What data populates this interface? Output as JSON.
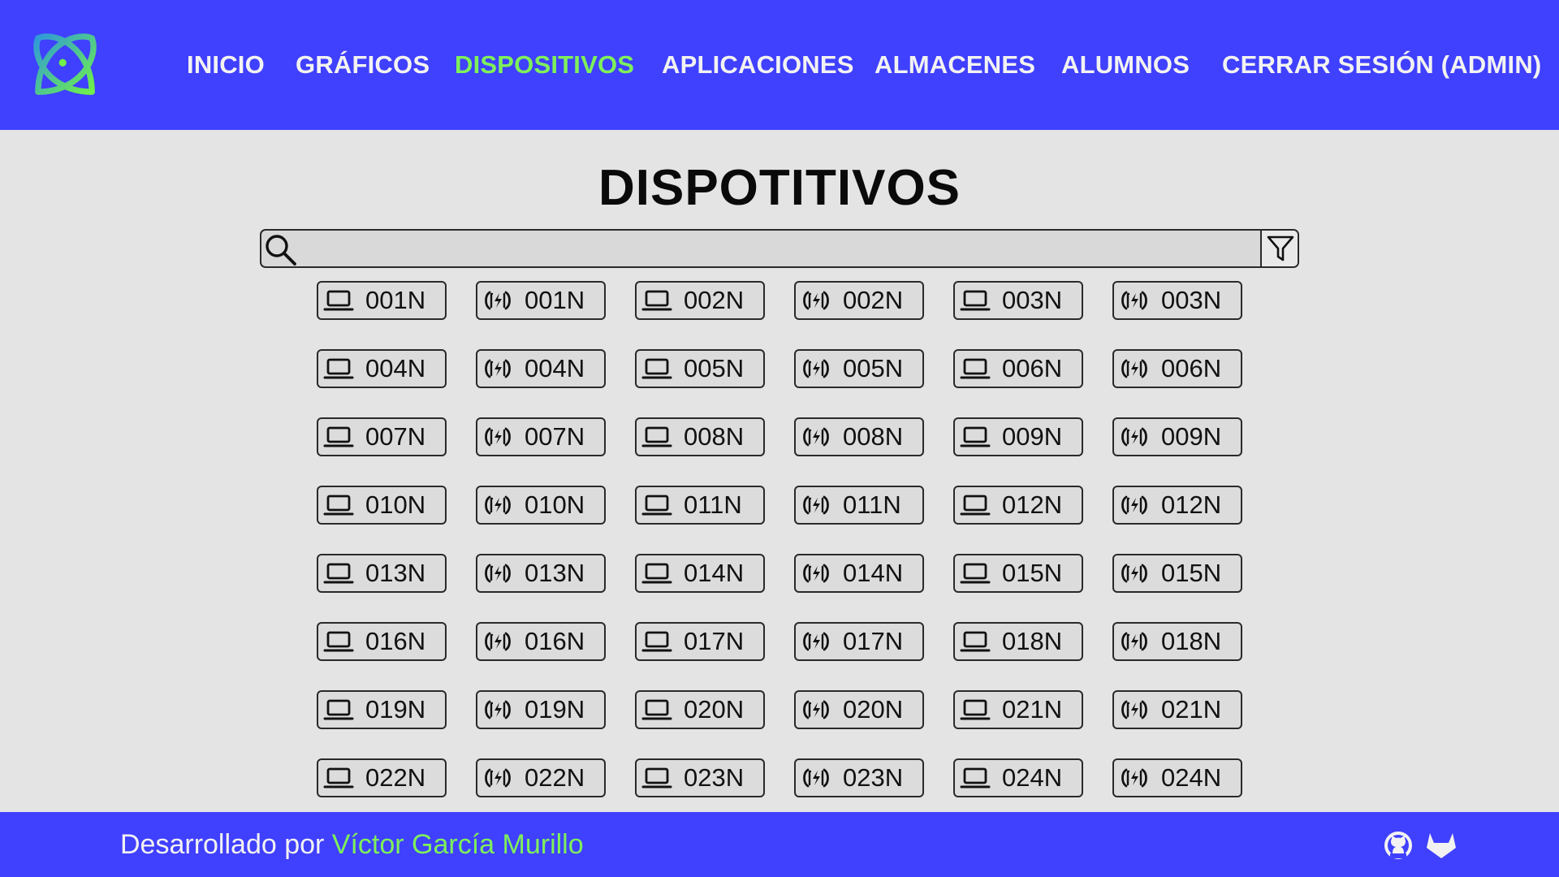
{
  "nav": {
    "items": [
      {
        "label": "INICIO",
        "active": false
      },
      {
        "label": "GRÁFICOS",
        "active": false
      },
      {
        "label": "DISPOSITIVOS",
        "active": true
      },
      {
        "label": "APLICACIONES",
        "active": false
      },
      {
        "label": "ALMACENES",
        "active": false
      },
      {
        "label": "ALUMNOS",
        "active": false
      },
      {
        "label": "CERRAR SESIÓN (ADMIN)",
        "active": false
      }
    ]
  },
  "page": {
    "title": "DISPOTITIVOS"
  },
  "search": {
    "value": "",
    "placeholder": "",
    "search_icon": "search-icon",
    "filter_icon": "filter-icon"
  },
  "devices": [
    {
      "type": "laptop",
      "label": "001N"
    },
    {
      "type": "charger",
      "label": "001N"
    },
    {
      "type": "laptop",
      "label": "002N"
    },
    {
      "type": "charger",
      "label": "002N"
    },
    {
      "type": "laptop",
      "label": "003N"
    },
    {
      "type": "charger",
      "label": "003N"
    },
    {
      "type": "laptop",
      "label": "004N"
    },
    {
      "type": "charger",
      "label": "004N"
    },
    {
      "type": "laptop",
      "label": "005N"
    },
    {
      "type": "charger",
      "label": "005N"
    },
    {
      "type": "laptop",
      "label": "006N"
    },
    {
      "type": "charger",
      "label": "006N"
    },
    {
      "type": "laptop",
      "label": "007N"
    },
    {
      "type": "charger",
      "label": "007N"
    },
    {
      "type": "laptop",
      "label": "008N"
    },
    {
      "type": "charger",
      "label": "008N"
    },
    {
      "type": "laptop",
      "label": "009N"
    },
    {
      "type": "charger",
      "label": "009N"
    },
    {
      "type": "laptop",
      "label": "010N"
    },
    {
      "type": "charger",
      "label": "010N"
    },
    {
      "type": "laptop",
      "label": "011N"
    },
    {
      "type": "charger",
      "label": "011N"
    },
    {
      "type": "laptop",
      "label": "012N"
    },
    {
      "type": "charger",
      "label": "012N"
    },
    {
      "type": "laptop",
      "label": "013N"
    },
    {
      "type": "charger",
      "label": "013N"
    },
    {
      "type": "laptop",
      "label": "014N"
    },
    {
      "type": "charger",
      "label": "014N"
    },
    {
      "type": "laptop",
      "label": "015N"
    },
    {
      "type": "charger",
      "label": "015N"
    },
    {
      "type": "laptop",
      "label": "016N"
    },
    {
      "type": "charger",
      "label": "016N"
    },
    {
      "type": "laptop",
      "label": "017N"
    },
    {
      "type": "charger",
      "label": "017N"
    },
    {
      "type": "laptop",
      "label": "018N"
    },
    {
      "type": "charger",
      "label": "018N"
    },
    {
      "type": "laptop",
      "label": "019N"
    },
    {
      "type": "charger",
      "label": "019N"
    },
    {
      "type": "laptop",
      "label": "020N"
    },
    {
      "type": "charger",
      "label": "020N"
    },
    {
      "type": "laptop",
      "label": "021N"
    },
    {
      "type": "charger",
      "label": "021N"
    },
    {
      "type": "laptop",
      "label": "022N"
    },
    {
      "type": "charger",
      "label": "022N"
    },
    {
      "type": "laptop",
      "label": "023N"
    },
    {
      "type": "charger",
      "label": "023N"
    },
    {
      "type": "laptop",
      "label": "024N"
    },
    {
      "type": "charger",
      "label": "024N"
    }
  ],
  "footer": {
    "prefix": "Desarrollado por ",
    "author": "Víctor García Murillo",
    "icons": [
      "github-icon",
      "gitlab-icon"
    ]
  },
  "colors": {
    "header_bg": "#4040ff",
    "accent": "#7ef05a",
    "nav_text": "#f2f2f2",
    "page_bg": "#e4e4e4",
    "button_bg": "#dcdcdc"
  }
}
